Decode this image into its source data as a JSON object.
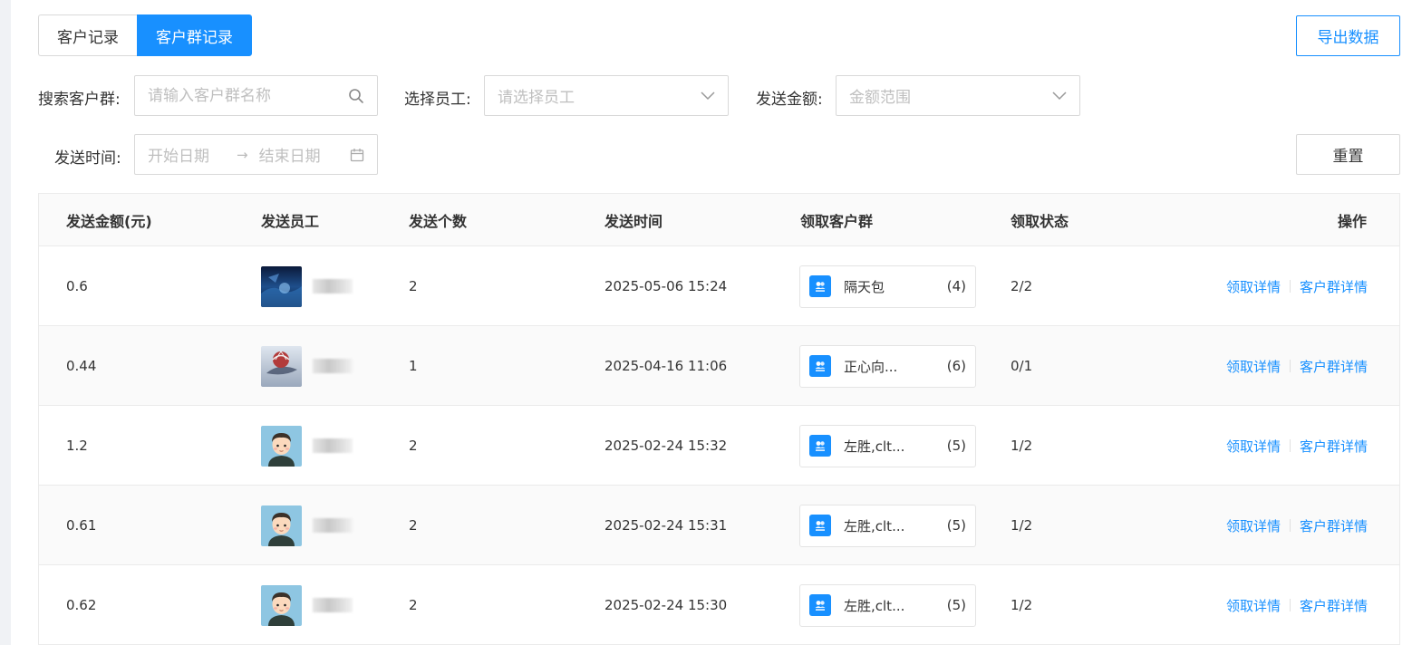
{
  "tabs": [
    "客户记录",
    "客户群记录"
  ],
  "active_tab": 1,
  "export_label": "导出数据",
  "reset_label": "重置",
  "filters": {
    "search_label": "搜索客户群:",
    "search_placeholder": "请输入客户群名称",
    "employee_label": "选择员工:",
    "employee_placeholder": "请选择员工",
    "amount_label": "发送金额:",
    "amount_placeholder": "金额范围",
    "time_label": "发送时间:",
    "start_placeholder": "开始日期",
    "end_placeholder": "结束日期",
    "range_arrow": "→"
  },
  "table": {
    "columns": [
      "发送金额(元)",
      "发送员工",
      "发送个数",
      "发送时间",
      "领取客户群",
      "领取状态",
      "操作"
    ],
    "rows": [
      {
        "amount": "0.6",
        "avatar": "scenery",
        "count": "2",
        "time": "2025-05-06 15:24",
        "group": "隔天包",
        "group_count": "(4)",
        "status": "2/2"
      },
      {
        "amount": "0.44",
        "avatar": "balloon",
        "count": "1",
        "time": "2025-04-16 11:06",
        "group": "正心向...",
        "group_count": "(6)",
        "status": "0/1"
      },
      {
        "amount": "1.2",
        "avatar": "cartoon",
        "count": "2",
        "time": "2025-02-24 15:32",
        "group": "左胜,clt...",
        "group_count": "(5)",
        "status": "1/2"
      },
      {
        "amount": "0.61",
        "avatar": "cartoon",
        "count": "2",
        "time": "2025-02-24 15:31",
        "group": "左胜,clt...",
        "group_count": "(5)",
        "status": "1/2"
      },
      {
        "amount": "0.62",
        "avatar": "cartoon",
        "count": "2",
        "time": "2025-02-24 15:30",
        "group": "左胜,clt...",
        "group_count": "(5)",
        "status": "1/2"
      }
    ],
    "op_detail": "领取详情",
    "op_group_detail": "客户群详情"
  },
  "colors": {
    "primary": "#1890ff",
    "border": "#d9d9d9",
    "header_bg": "#fafafa"
  },
  "icons": [
    "search-icon",
    "chevron-down-icon",
    "calendar-icon",
    "group-icon"
  ]
}
